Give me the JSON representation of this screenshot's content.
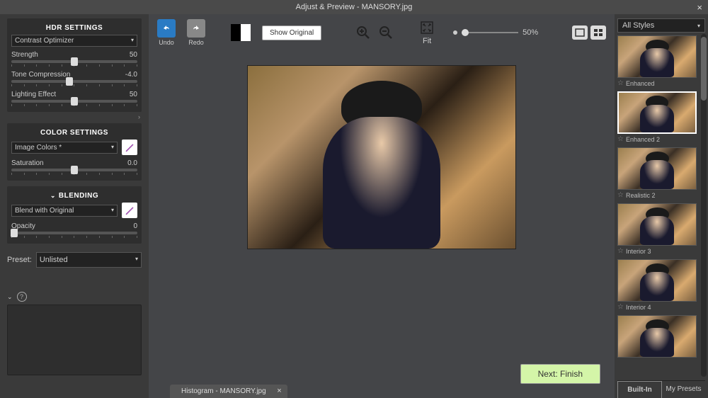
{
  "title": "Adjust & Preview - MANSORY.jpg",
  "left": {
    "hdr": {
      "header": "HDR SETTINGS",
      "method": "Contrast Optimizer",
      "sliders": [
        {
          "label": "Strength",
          "value": "50",
          "pos": 50
        },
        {
          "label": "Tone Compression",
          "value": "-4.0",
          "pos": 46
        },
        {
          "label": "Lighting Effect",
          "value": "50",
          "pos": 50
        }
      ]
    },
    "color": {
      "header": "COLOR SETTINGS",
      "method": "Image Colors *",
      "sliders": [
        {
          "label": "Saturation",
          "value": "0.0",
          "pos": 50
        }
      ]
    },
    "blend": {
      "header": "BLENDING",
      "method": "Blend with Original",
      "sliders": [
        {
          "label": "Opacity",
          "value": "0",
          "pos": 2
        }
      ]
    },
    "preset_label": "Preset:",
    "preset_value": "Unlisted"
  },
  "toolbar": {
    "undo": "Undo",
    "redo": "Redo",
    "show_original": "Show Original",
    "fit": "Fit",
    "zoom_pct": "50%"
  },
  "next_button": "Next: Finish",
  "histogram": "Histogram - MANSORY.jpg",
  "right": {
    "styles_dd": "All Styles",
    "thumbs": [
      {
        "label": "Enhanced",
        "selected": false
      },
      {
        "label": "Enhanced 2",
        "selected": true
      },
      {
        "label": "Realistic 2",
        "selected": false
      },
      {
        "label": "Interior 3",
        "selected": false
      },
      {
        "label": "Interior 4",
        "selected": false
      },
      {
        "label": "",
        "selected": false
      }
    ],
    "tab_builtin": "Built-In",
    "tab_mypresets": "My Presets"
  }
}
